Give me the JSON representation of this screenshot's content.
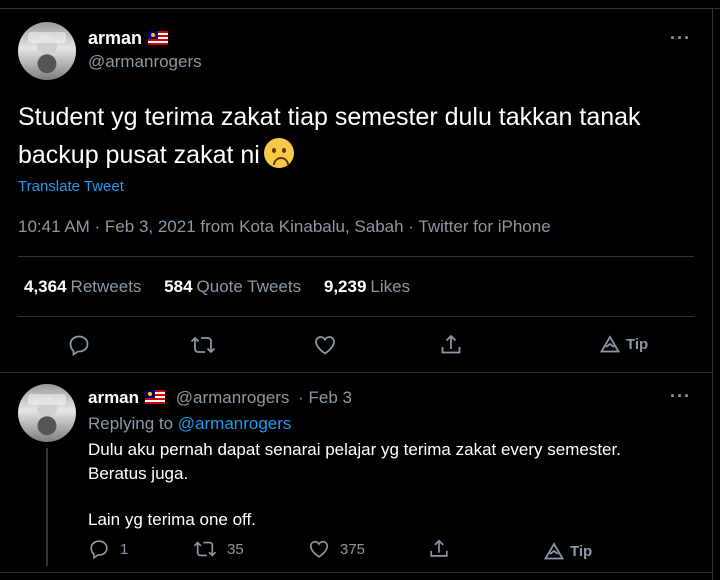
{
  "tweet": {
    "author_name": "arman",
    "author_handle": "@armanrogers",
    "more": "···",
    "text": "Student yg terima zakat tiap semester dulu takkan tanak backup pusat zakat ni",
    "translate": "Translate Tweet",
    "meta": "10:41 AM · Feb 3, 2021 from Kota Kinabalu, Sabah · Twitter for iPhone",
    "stats": {
      "retweets_count": "4,364",
      "retweets_label": "Retweets",
      "quotes_count": "584",
      "quotes_label": "Quote Tweets",
      "likes_count": "9,239",
      "likes_label": "Likes"
    },
    "tip_label": "Tip",
    "icons": [
      "reply-icon",
      "retweet-icon",
      "like-icon",
      "share-icon",
      "tip-icon"
    ]
  },
  "reply": {
    "author_name": "arman",
    "author_handle": "@armanrogers",
    "date": "· Feb 3",
    "more": "···",
    "replying_label": "Replying to",
    "replying_handle": "@armanrogers",
    "line1": "Dulu aku pernah dapat senarai pelajar yg terima zakat every semester.",
    "line2": "Beratus juga.",
    "line3": "Lain yg terima one off.",
    "reply_count": "1",
    "retweet_count": "35",
    "like_count": "375",
    "tip_label": "Tip"
  },
  "colors": {
    "background": "#000000",
    "text": "#ffffff",
    "secondary": "#8b98a5",
    "link": "#1d9bf0",
    "divider": "#2f3336"
  }
}
